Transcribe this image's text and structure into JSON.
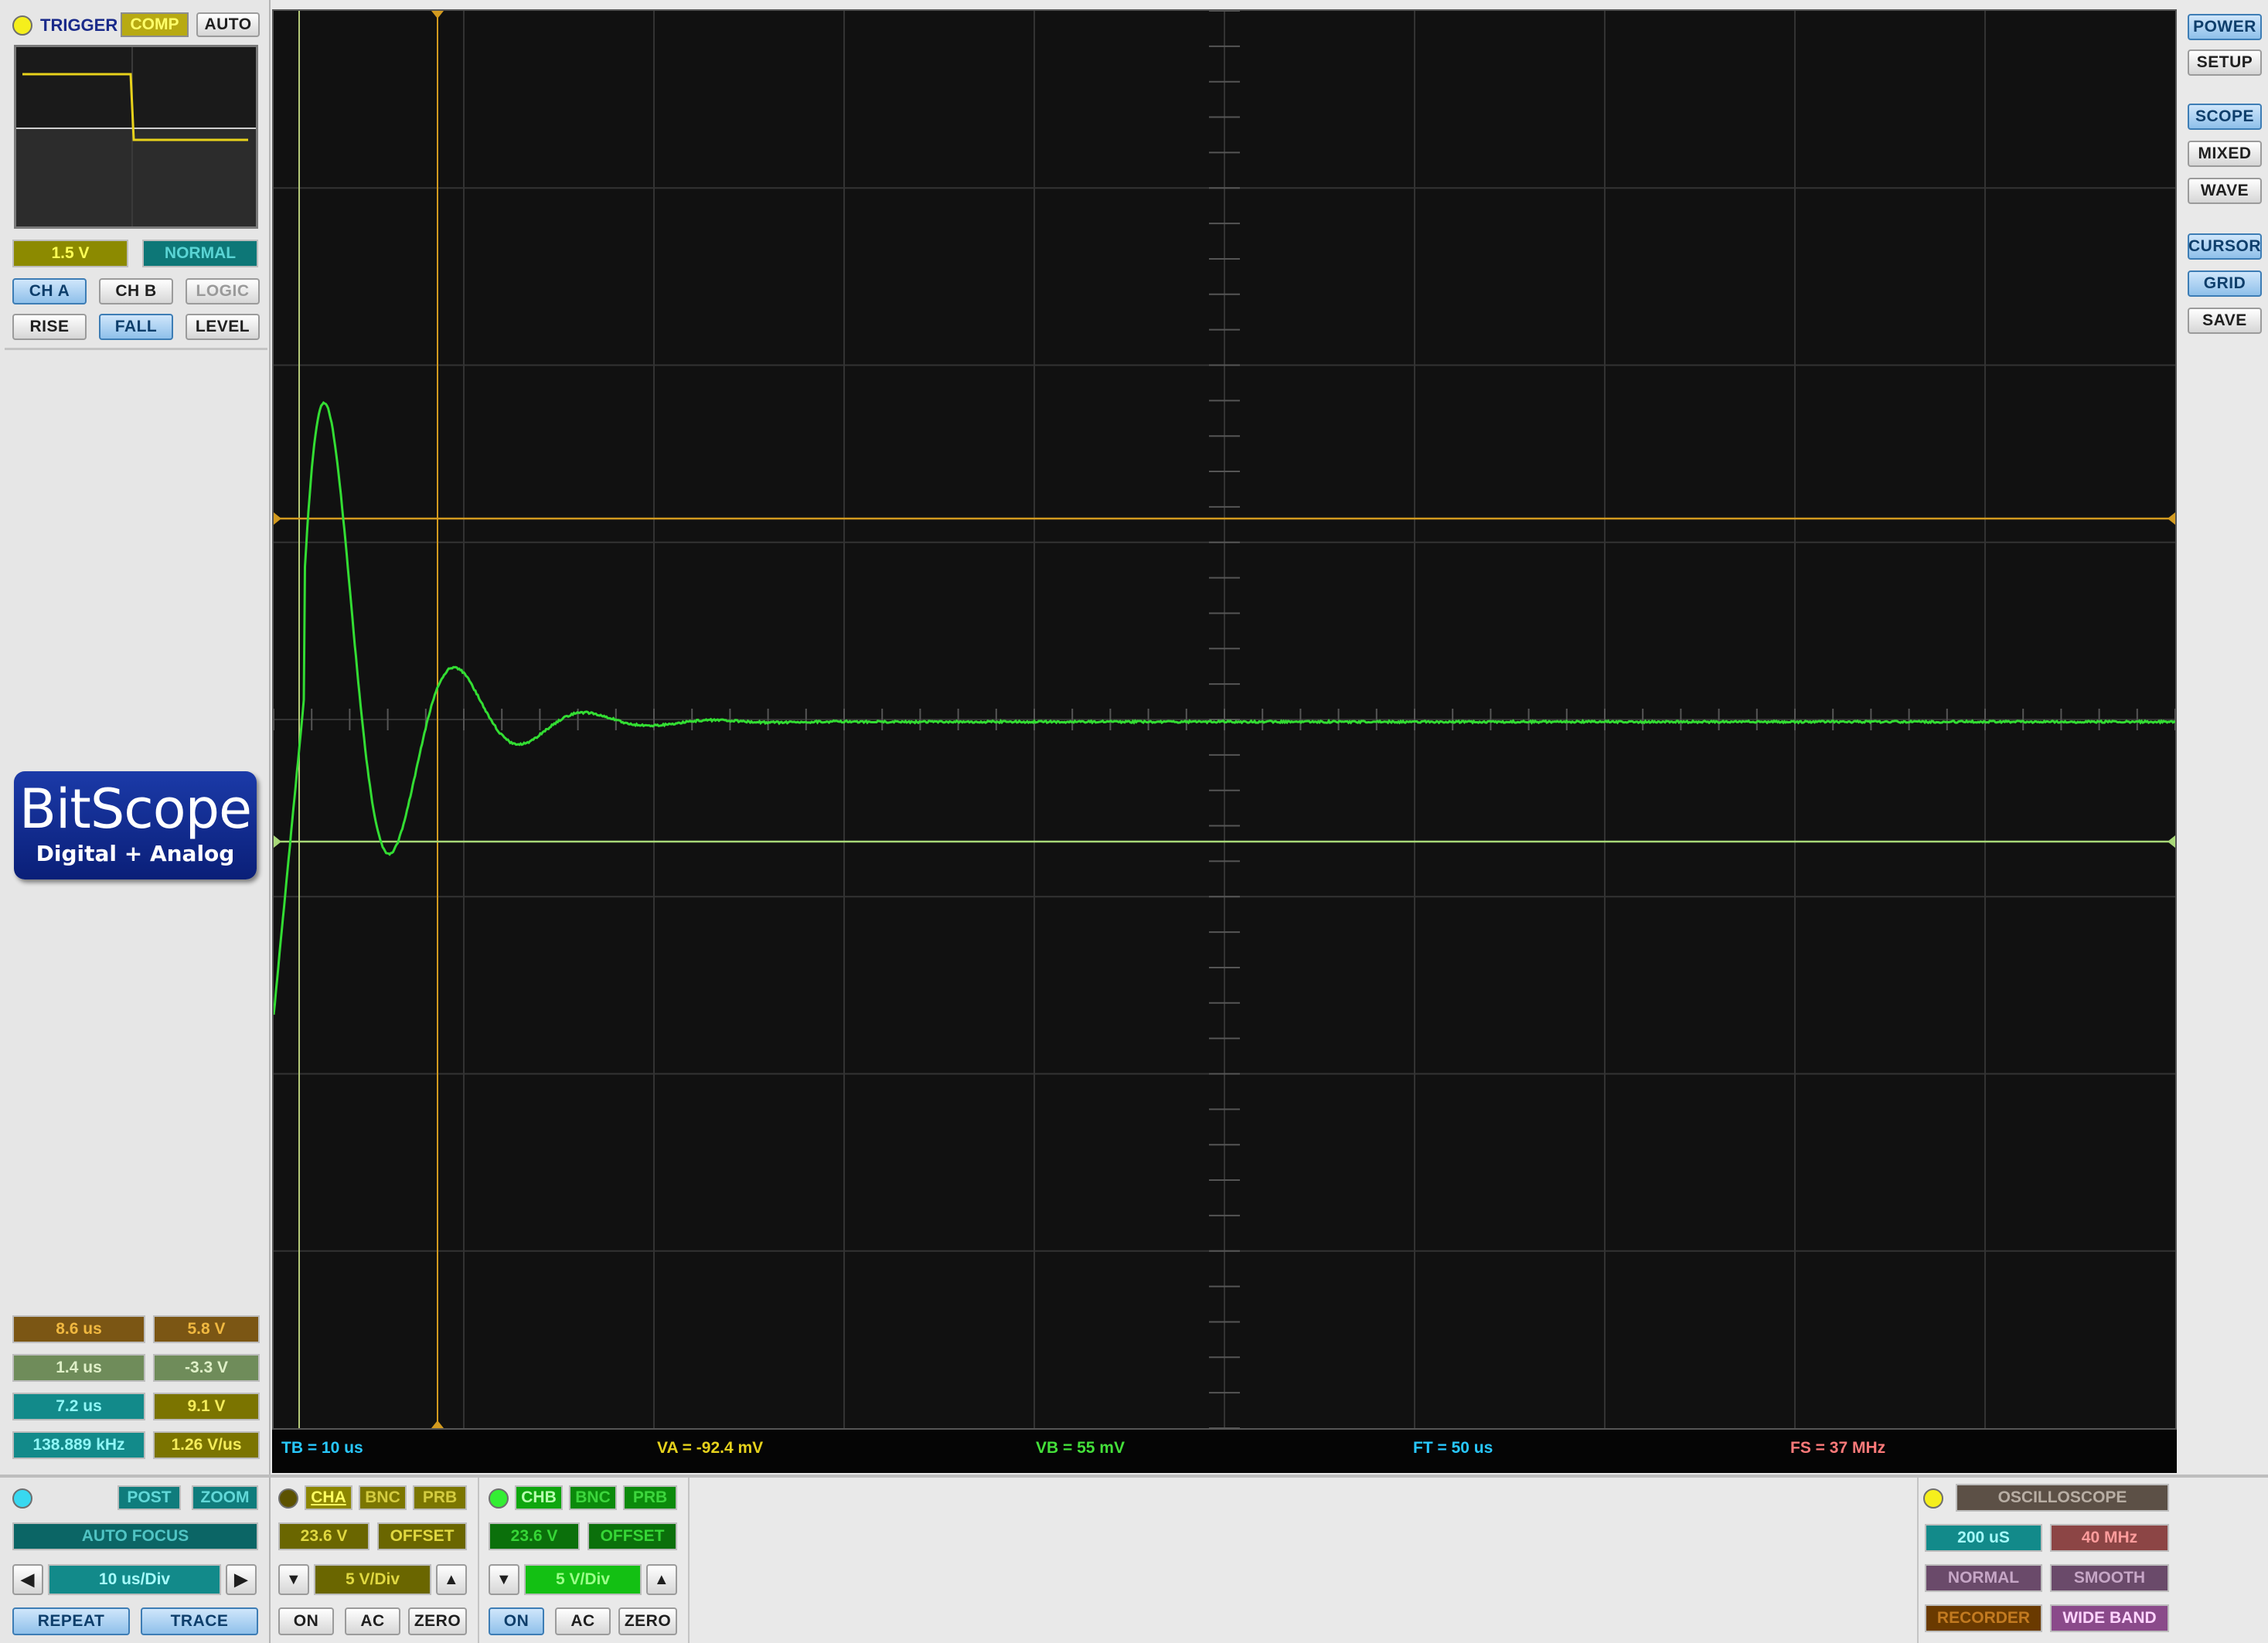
{
  "trigger": {
    "label": "TRIGGER",
    "comp": "COMP",
    "auto": "AUTO",
    "level_value": "1.5 V",
    "mode": "NORMAL",
    "sources": [
      "CH A",
      "CH B",
      "LOGIC"
    ],
    "edges": [
      "RISE",
      "FALL",
      "LEVEL"
    ]
  },
  "logo": {
    "title": "BitScope",
    "subtitle": "Digital + Analog"
  },
  "measurements": [
    [
      "8.6 us",
      "5.8 V"
    ],
    [
      "1.4 us",
      "-3.3 V"
    ],
    [
      "7.2 us",
      "9.1 V"
    ],
    [
      "138.889  kHz",
      "1.26 V/us"
    ]
  ],
  "timebase": {
    "post": "POST",
    "zoom": "ZOOM",
    "auto_focus": "AUTO FOCUS",
    "value": "10 us/Div",
    "repeat": "REPEAT",
    "trace": "TRACE"
  },
  "channel_a": {
    "name": "CHA",
    "bnc": "BNC",
    "prb": "PRB",
    "range": "23.6 V",
    "offset": "OFFSET",
    "vdiv": "5 V/Div",
    "on": "ON",
    "ac": "AC",
    "zero": "ZERO"
  },
  "channel_b": {
    "name": "CHB",
    "bnc": "BNC",
    "prb": "PRB",
    "range": "23.6 V",
    "offset": "OFFSET",
    "vdiv": "5 V/Div",
    "on": "ON",
    "ac": "AC",
    "zero": "ZERO"
  },
  "status": {
    "tb": "TB = 10 us",
    "va": "VA = -92.4 mV",
    "vb": "VB = 55 mV",
    "ft": "FT = 50 us",
    "fs": "FS = 37 MHz"
  },
  "right_panel": {
    "power": "POWER",
    "setup": "SETUP",
    "scope": "SCOPE",
    "mixed": "MIXED",
    "wave": "WAVE",
    "cursor": "CURSOR",
    "grid": "GRID",
    "save": "SAVE"
  },
  "capture": {
    "mode": "OSCILLOSCOPE",
    "duration": "200 uS",
    "rate": "40 MHz",
    "normal": "NORMAL",
    "smooth": "SMOOTH",
    "recorder": "RECORDER",
    "wide_band": "WIDE BAND"
  },
  "colors": {
    "trace": "#33dd33",
    "cursor": "#d29a1f",
    "screen_bg": "#111111",
    "status_tb": "#28c8ff",
    "status_va": "#e6d21c",
    "status_vb": "#44e03a",
    "status_ft": "#28c8ff",
    "status_fs": "#ff7a7a"
  }
}
